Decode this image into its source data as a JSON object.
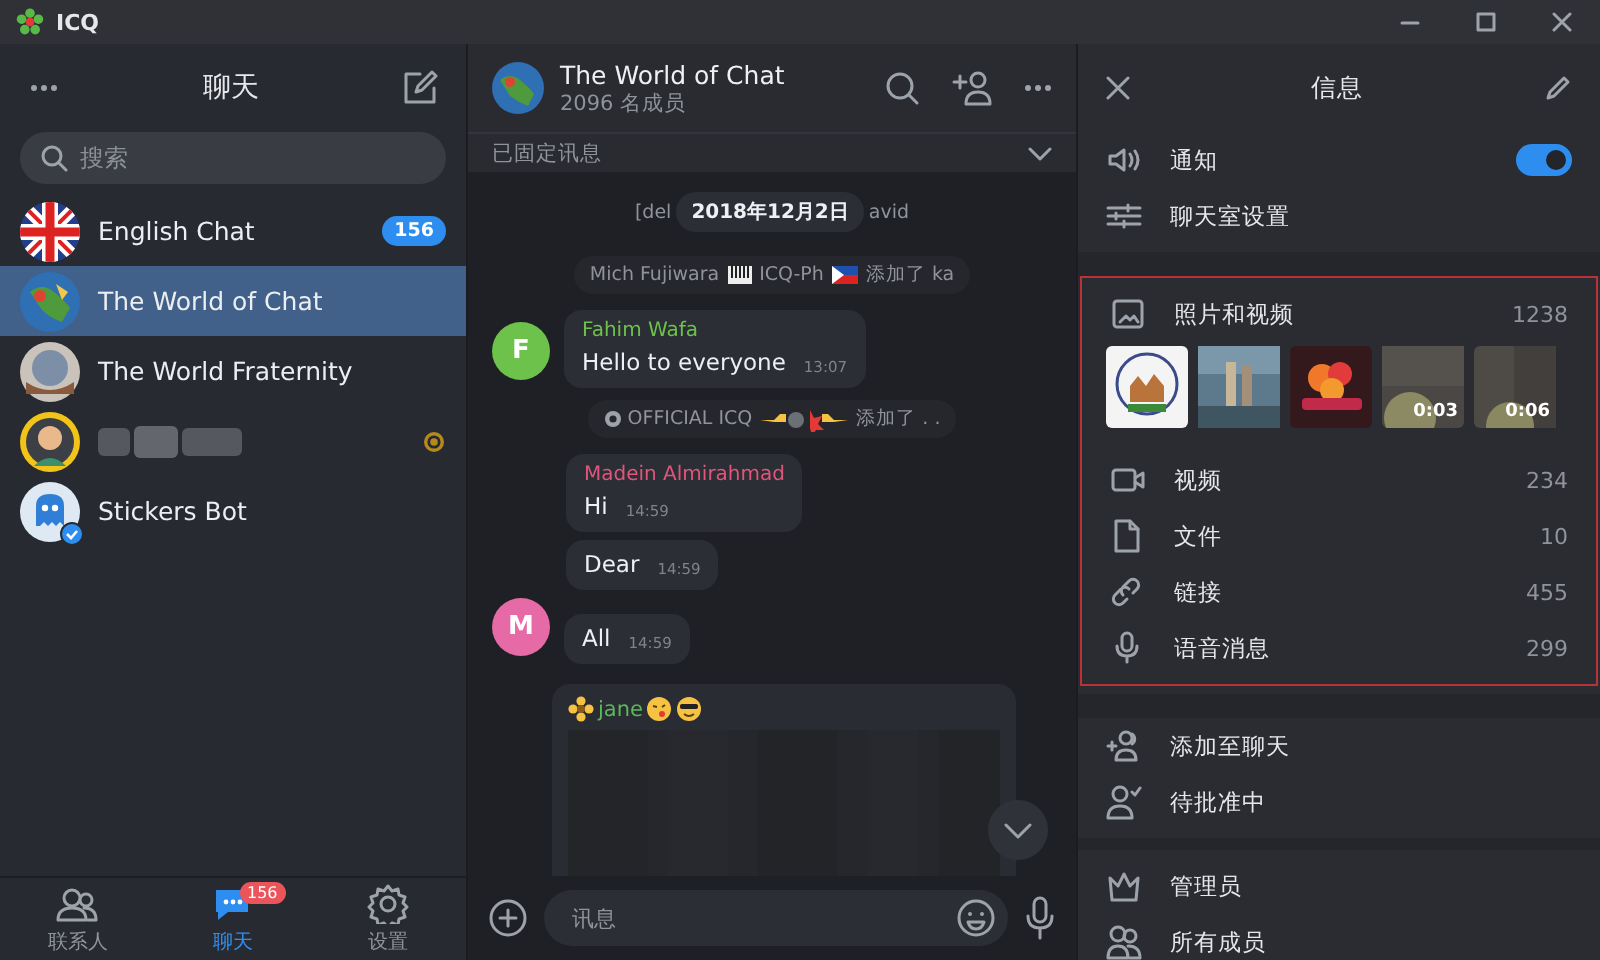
{
  "window": {
    "title": "ICQ"
  },
  "sidebar": {
    "title": "聊天",
    "search": {
      "placeholder": "搜索"
    },
    "chats": [
      {
        "kind": "chat",
        "name": "English Chat",
        "badge": "156",
        "selected": false
      },
      {
        "kind": "chat",
        "name": "The World of Chat",
        "selected": true
      },
      {
        "kind": "chat",
        "name": "The World Fraternity",
        "selected": false
      },
      {
        "kind": "blurred",
        "selected": false
      },
      {
        "kind": "chat",
        "name": "Stickers Bot",
        "selected": false
      }
    ],
    "tabs": [
      {
        "label": "联系人",
        "selected": false
      },
      {
        "label": "聊天",
        "selected": true,
        "badge": "156"
      },
      {
        "label": "设置",
        "selected": false
      }
    ]
  },
  "chat": {
    "title": "The World of Chat",
    "subtitle": "2096 名成员",
    "pinned": "已固定讯息",
    "messages": [
      {
        "kind": "date",
        "left": "[del",
        "date": "2018年12月2日",
        "right": "avid"
      },
      {
        "kind": "service",
        "parts": [
          "Mich Fujiwara",
          "ICQ-Ph",
          "添加了 ka"
        ]
      },
      {
        "kind": "message",
        "sender": "Fahim Wafa",
        "color": "#6cc24a",
        "text": "Hello to everyone",
        "time": "13:07",
        "avatar": "F"
      },
      {
        "kind": "service",
        "parts": [
          "OFFICIAL ICQ",
          "添加了 . ."
        ]
      },
      {
        "kind": "message",
        "sender": "Madein Almirahmad",
        "color": "#e0557a",
        "text": "Hi",
        "time": "14:59"
      },
      {
        "kind": "message",
        "text": "Dear",
        "time": "14:59"
      },
      {
        "kind": "message",
        "text": "All",
        "time": "14:59",
        "avatar": "M",
        "color": "#e66aa6"
      },
      {
        "kind": "card",
        "sender": "jane",
        "color": "#5cb85c"
      }
    ],
    "composer": {
      "placeholder": "讯息"
    }
  },
  "info": {
    "title": "信息",
    "notifications": {
      "label": "通知",
      "on": true
    },
    "settings": "聊天室设置",
    "media": {
      "label": "照片和视频",
      "count": "1238",
      "thumbs": [
        {
          "kind": "picture"
        },
        {
          "kind": "picture"
        },
        {
          "kind": "picture"
        },
        {
          "kind": "video",
          "duration": "0:03"
        },
        {
          "kind": "video",
          "duration": "0:06"
        }
      ]
    },
    "stats": [
      {
        "label": "视频",
        "count": "234"
      },
      {
        "label": "文件",
        "count": "10"
      },
      {
        "label": "链接",
        "count": "455"
      },
      {
        "label": "语音消息",
        "count": "299"
      }
    ],
    "actions": [
      {
        "label": "添加至聊天"
      },
      {
        "label": "待批准中"
      }
    ],
    "members": [
      {
        "label": "管理员"
      },
      {
        "label": "所有成员"
      }
    ]
  }
}
